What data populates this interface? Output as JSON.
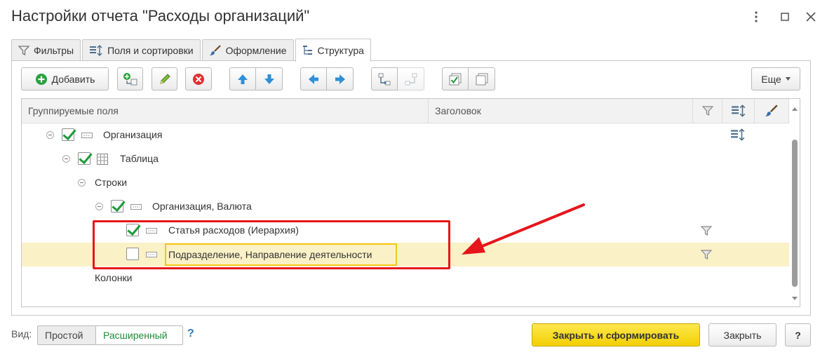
{
  "window": {
    "title": "Настройки отчета \"Расходы организаций\""
  },
  "tabs": [
    {
      "label": "Фильтры",
      "icon": "filter-icon"
    },
    {
      "label": "Поля и сортировки",
      "icon": "fields-sort-icon"
    },
    {
      "label": "Оформление",
      "icon": "brush-icon"
    },
    {
      "label": "Структура",
      "icon": "structure-icon",
      "active": true
    }
  ],
  "toolbar": {
    "add_label": "Добавить",
    "more_label": "Еще"
  },
  "grid": {
    "columns": [
      "Группируемые поля",
      "Заголовок"
    ],
    "rows": [
      {
        "label": "Организация",
        "checked": true
      },
      {
        "label": "Таблица",
        "checked": true
      },
      {
        "label": "Строки"
      },
      {
        "label": "Организация, Валюта",
        "checked": true
      },
      {
        "label": "Статья расходов (Иерархия)",
        "checked": true
      },
      {
        "label": "Подразделение, Направление деятельности",
        "checked": false,
        "selected": true
      },
      {
        "label": "Колонки"
      }
    ]
  },
  "bottom": {
    "view_label": "Вид:",
    "view_simple": "Простой",
    "view_extended": "Расширенный",
    "help_hint": "?",
    "close_and_build": "Закрыть и сформировать",
    "close": "Закрыть",
    "help": "?"
  },
  "colors": {
    "accent_yellow": "#f2cf04",
    "selection": "#fbf1c6",
    "annotation_red": "#e5161b",
    "check_green": "#1d9a3a"
  }
}
